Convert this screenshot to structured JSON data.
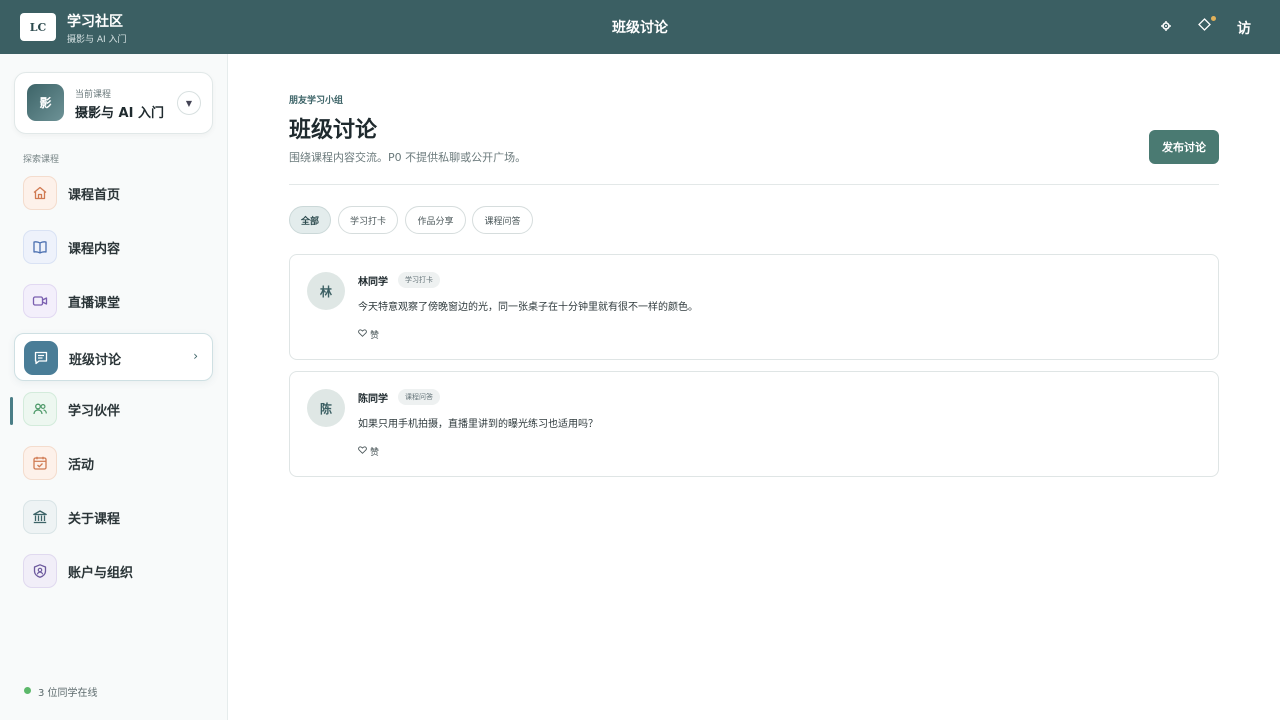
{
  "header": {
    "logo": "LC",
    "brand_title": "学习社区",
    "brand_sub": "摄影与 AI 入门",
    "center_title": "班级讨论",
    "user": "访"
  },
  "sidebar": {
    "course_card": {
      "avatar": "影",
      "caption": "当前课程",
      "name": "摄影与 AI 入门"
    },
    "section_label": "探索课程",
    "items": [
      {
        "label": "课程首页",
        "icon": "home-icon"
      },
      {
        "label": "课程内容",
        "icon": "book-icon"
      },
      {
        "label": "直播课堂",
        "icon": "video-icon"
      },
      {
        "label": "班级讨论",
        "icon": "chat-icon",
        "active": true
      },
      {
        "label": "学习伙伴",
        "icon": "people-icon"
      },
      {
        "label": "活动",
        "icon": "calendar-icon"
      },
      {
        "label": "关于课程",
        "icon": "bank-icon"
      },
      {
        "label": "账户与组织",
        "icon": "shield-icon"
      }
    ],
    "online_text": "3 位同学在线"
  },
  "main": {
    "eyebrow": "朋友学习小组",
    "title": "班级讨论",
    "description": "围绕课程内容交流。P0 不提供私聊或公开广场。",
    "publish_label": "发布讨论",
    "filters": [
      {
        "label": "全部",
        "active": true
      },
      {
        "label": "学习打卡",
        "active": false
      },
      {
        "label": "作品分享",
        "active": false
      },
      {
        "label": "课程问答",
        "active": false
      }
    ],
    "posts": [
      {
        "avatar": "林",
        "author": "林同学",
        "tag": "学习打卡",
        "body": "今天特意观察了傍晚窗边的光，同一张桌子在十分钟里就有很不一样的颜色。",
        "like": "赞"
      },
      {
        "avatar": "陈",
        "author": "陈同学",
        "tag": "课程问答",
        "body": "如果只用手机拍摄，直播里讲到的曝光练习也适用吗？",
        "like": "赞"
      }
    ]
  },
  "colors": {
    "topbar": "#3b5f63",
    "accent": "#4a7a72",
    "online": "#5cb86a"
  }
}
